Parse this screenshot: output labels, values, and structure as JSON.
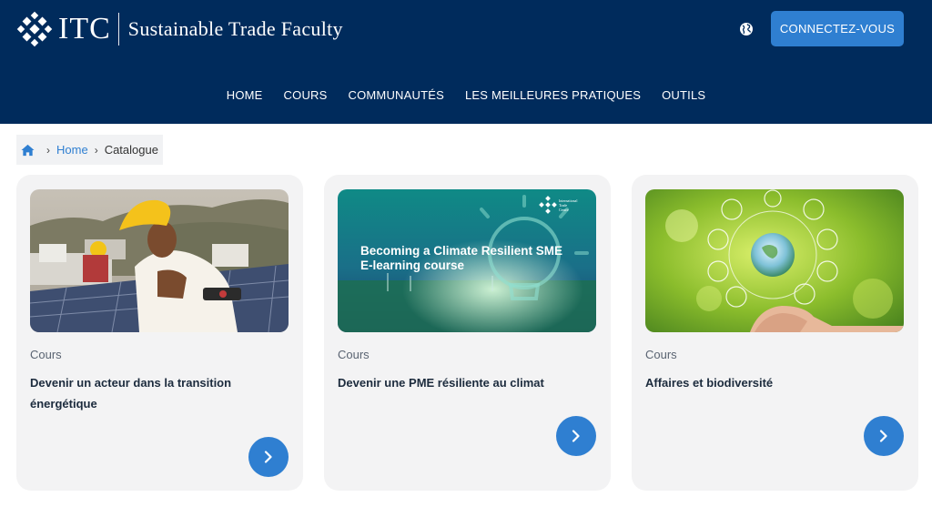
{
  "header": {
    "logo_text": "ITC",
    "logo_subtitle": "Sustainable Trade Faculty",
    "language_icon": "globe-icon",
    "login_label": "CONNECTEZ-VOUS"
  },
  "nav": {
    "items": [
      "HOME",
      "COURS",
      "COMMUNAUTÉS",
      "LES MEILLEURES PRATIQUES",
      "OUTILS"
    ]
  },
  "breadcrumb": {
    "home_icon": "home-icon",
    "home": "Home",
    "current": "Catalogue"
  },
  "cards": [
    {
      "type": "Cours",
      "title": "Devenir un acteur dans la transition énergétique",
      "image": "woman-with-solar-panels"
    },
    {
      "type": "Cours",
      "title": "Devenir une PME résiliente au climat",
      "image": "climate-resilient-sme-banner",
      "image_text": "Becoming a Climate Resilient SME E-learning course",
      "image_logo_text": "International Trade Centre"
    },
    {
      "type": "Cours",
      "title": "Affaires et biodiversité",
      "image": "hands-holding-earth-bulb"
    }
  ],
  "colors": {
    "header_bg": "#002b5c",
    "accent": "#2f7fd1",
    "card_bg": "#f3f3f4"
  }
}
